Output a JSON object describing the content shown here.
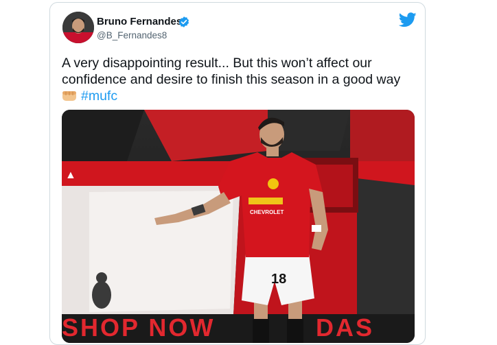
{
  "tweet": {
    "author": {
      "display_name": "Bruno Fernandes",
      "handle": "@B_Fernandes8",
      "verified": true
    },
    "text": "A very disappointing result... But this won’t affect our confidence and desire to finish this season in a good way",
    "emoji": "fist-icon",
    "hashtag": "#mufc",
    "media": {
      "type": "photo",
      "overlay_text": "SHOP NOW",
      "sponsor": "CHEVROLET",
      "shirt_number": "18"
    }
  },
  "colors": {
    "accent": "#1d9bf0",
    "text": "#0f1419",
    "secondary": "#536471",
    "kit_red": "#d4151e"
  }
}
